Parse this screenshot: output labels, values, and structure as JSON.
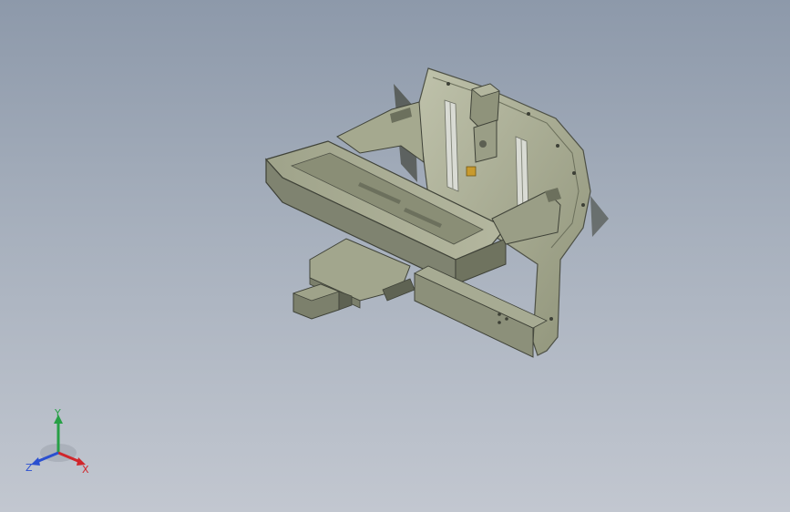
{
  "viewport": {
    "background_top": "#8d99aa",
    "background_bottom": "#c2c7d0",
    "model_body_color": "#a3a78c",
    "model_shadow_color": "#5d6052",
    "accent_part_color": "#c89a2e"
  },
  "triad": {
    "x_label": "X",
    "y_label": "Y",
    "z_label": "Z",
    "x_color": "#d0262b",
    "y_color": "#27a046",
    "z_color": "#2a4fd0"
  }
}
